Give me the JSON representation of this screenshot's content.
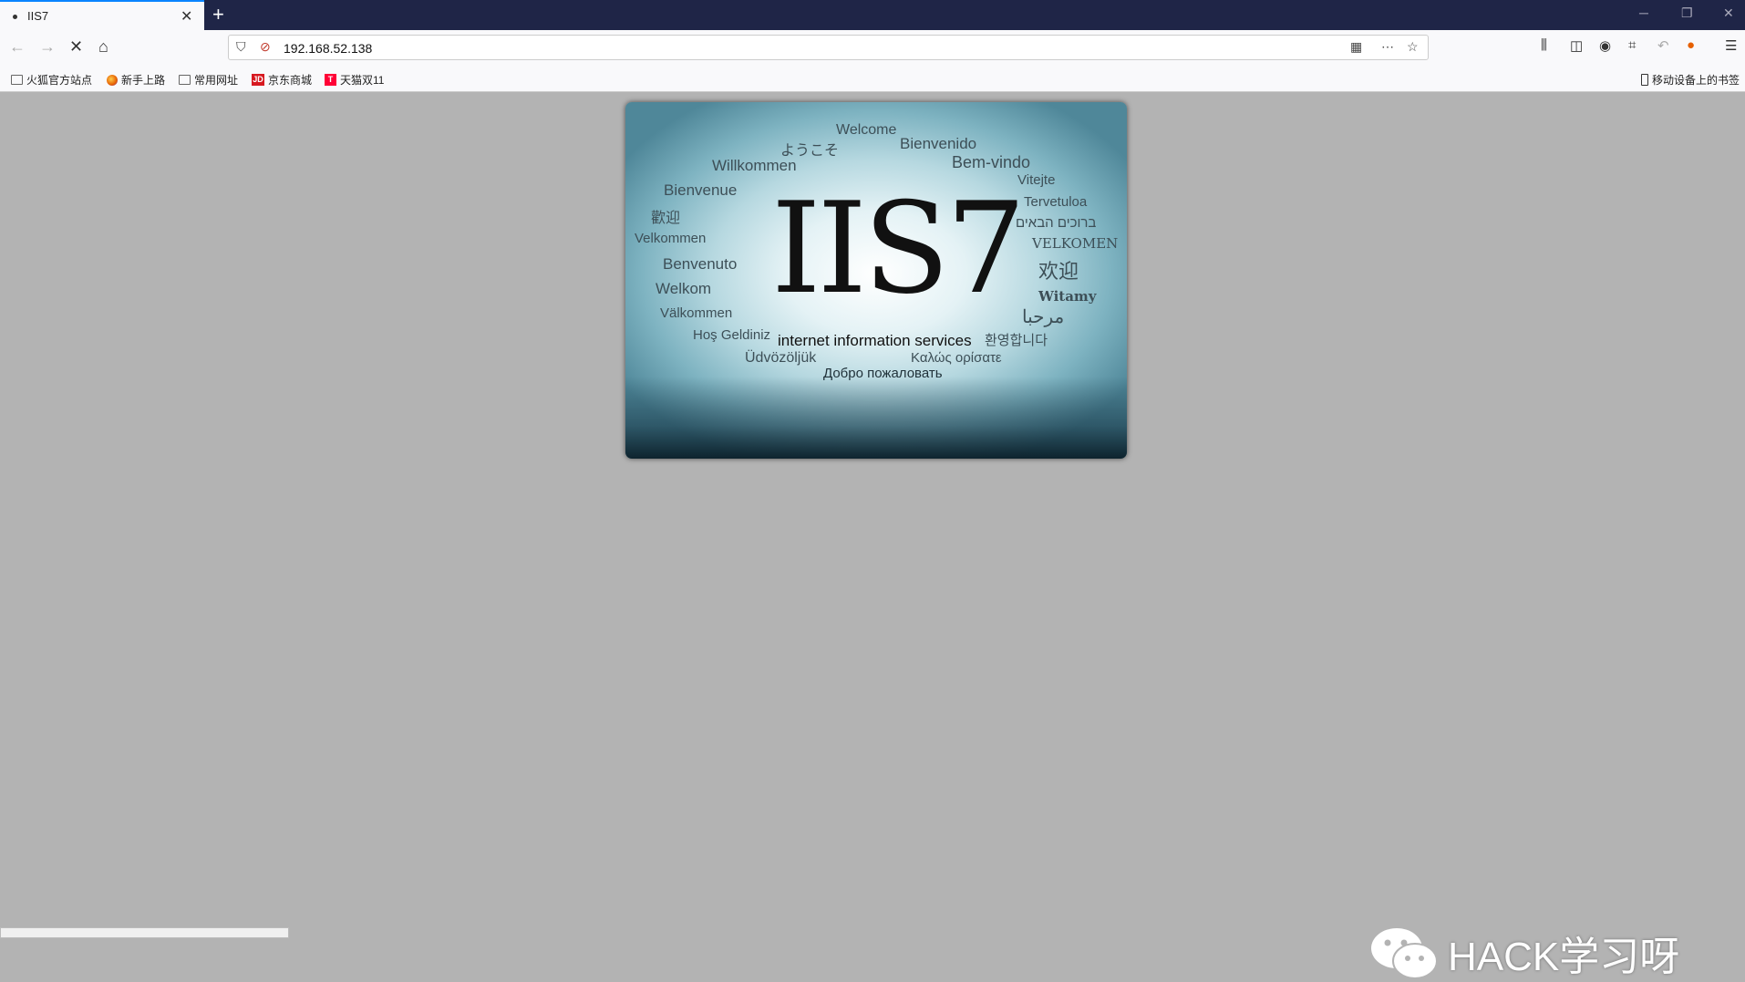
{
  "browser": {
    "tab": {
      "title": "IIS7",
      "close_icon": "close-icon"
    },
    "new_tab_label": "+",
    "address": "192.168.52.138",
    "bookmarks": [
      {
        "label": "火狐官方站点",
        "icon": "folder-icon"
      },
      {
        "label": "新手上路",
        "icon": "firefox-icon"
      },
      {
        "label": "常用网址",
        "icon": "folder-icon"
      },
      {
        "label": "京东商城",
        "icon": "jd-icon",
        "icon_text": "JD"
      },
      {
        "label": "天猫双11",
        "icon": "tmall-icon",
        "icon_text": "T"
      }
    ],
    "mobile_bookmarks": "移动设备上的书签"
  },
  "page": {
    "logo": "IIS7",
    "subtitle": "internet information services",
    "welcome_words": [
      "Welcome",
      "ようこそ",
      "Bienvenido",
      "Willkommen",
      "Bem-vindo",
      "Vitejte",
      "Bienvenue",
      "Tervetuloa",
      "歡迎",
      "ברוכים הבאים",
      "Velkommen",
      "VELKOMEN",
      "Benvenuto",
      "欢迎",
      "Welkom",
      "Witamy",
      "Välkommen",
      "مرحبا",
      "Hoş Geldiniz",
      "환영합니다",
      "Üdvözöljük",
      "Καλώς ορίσατε",
      "Добро пожаловать"
    ]
  },
  "watermark": {
    "text": "HACK学习呀",
    "icon": "wechat-icon"
  },
  "colors": {
    "tabbar": "#1f2547",
    "page_bg": "#b3b3b3",
    "accent": "#0a84ff"
  }
}
